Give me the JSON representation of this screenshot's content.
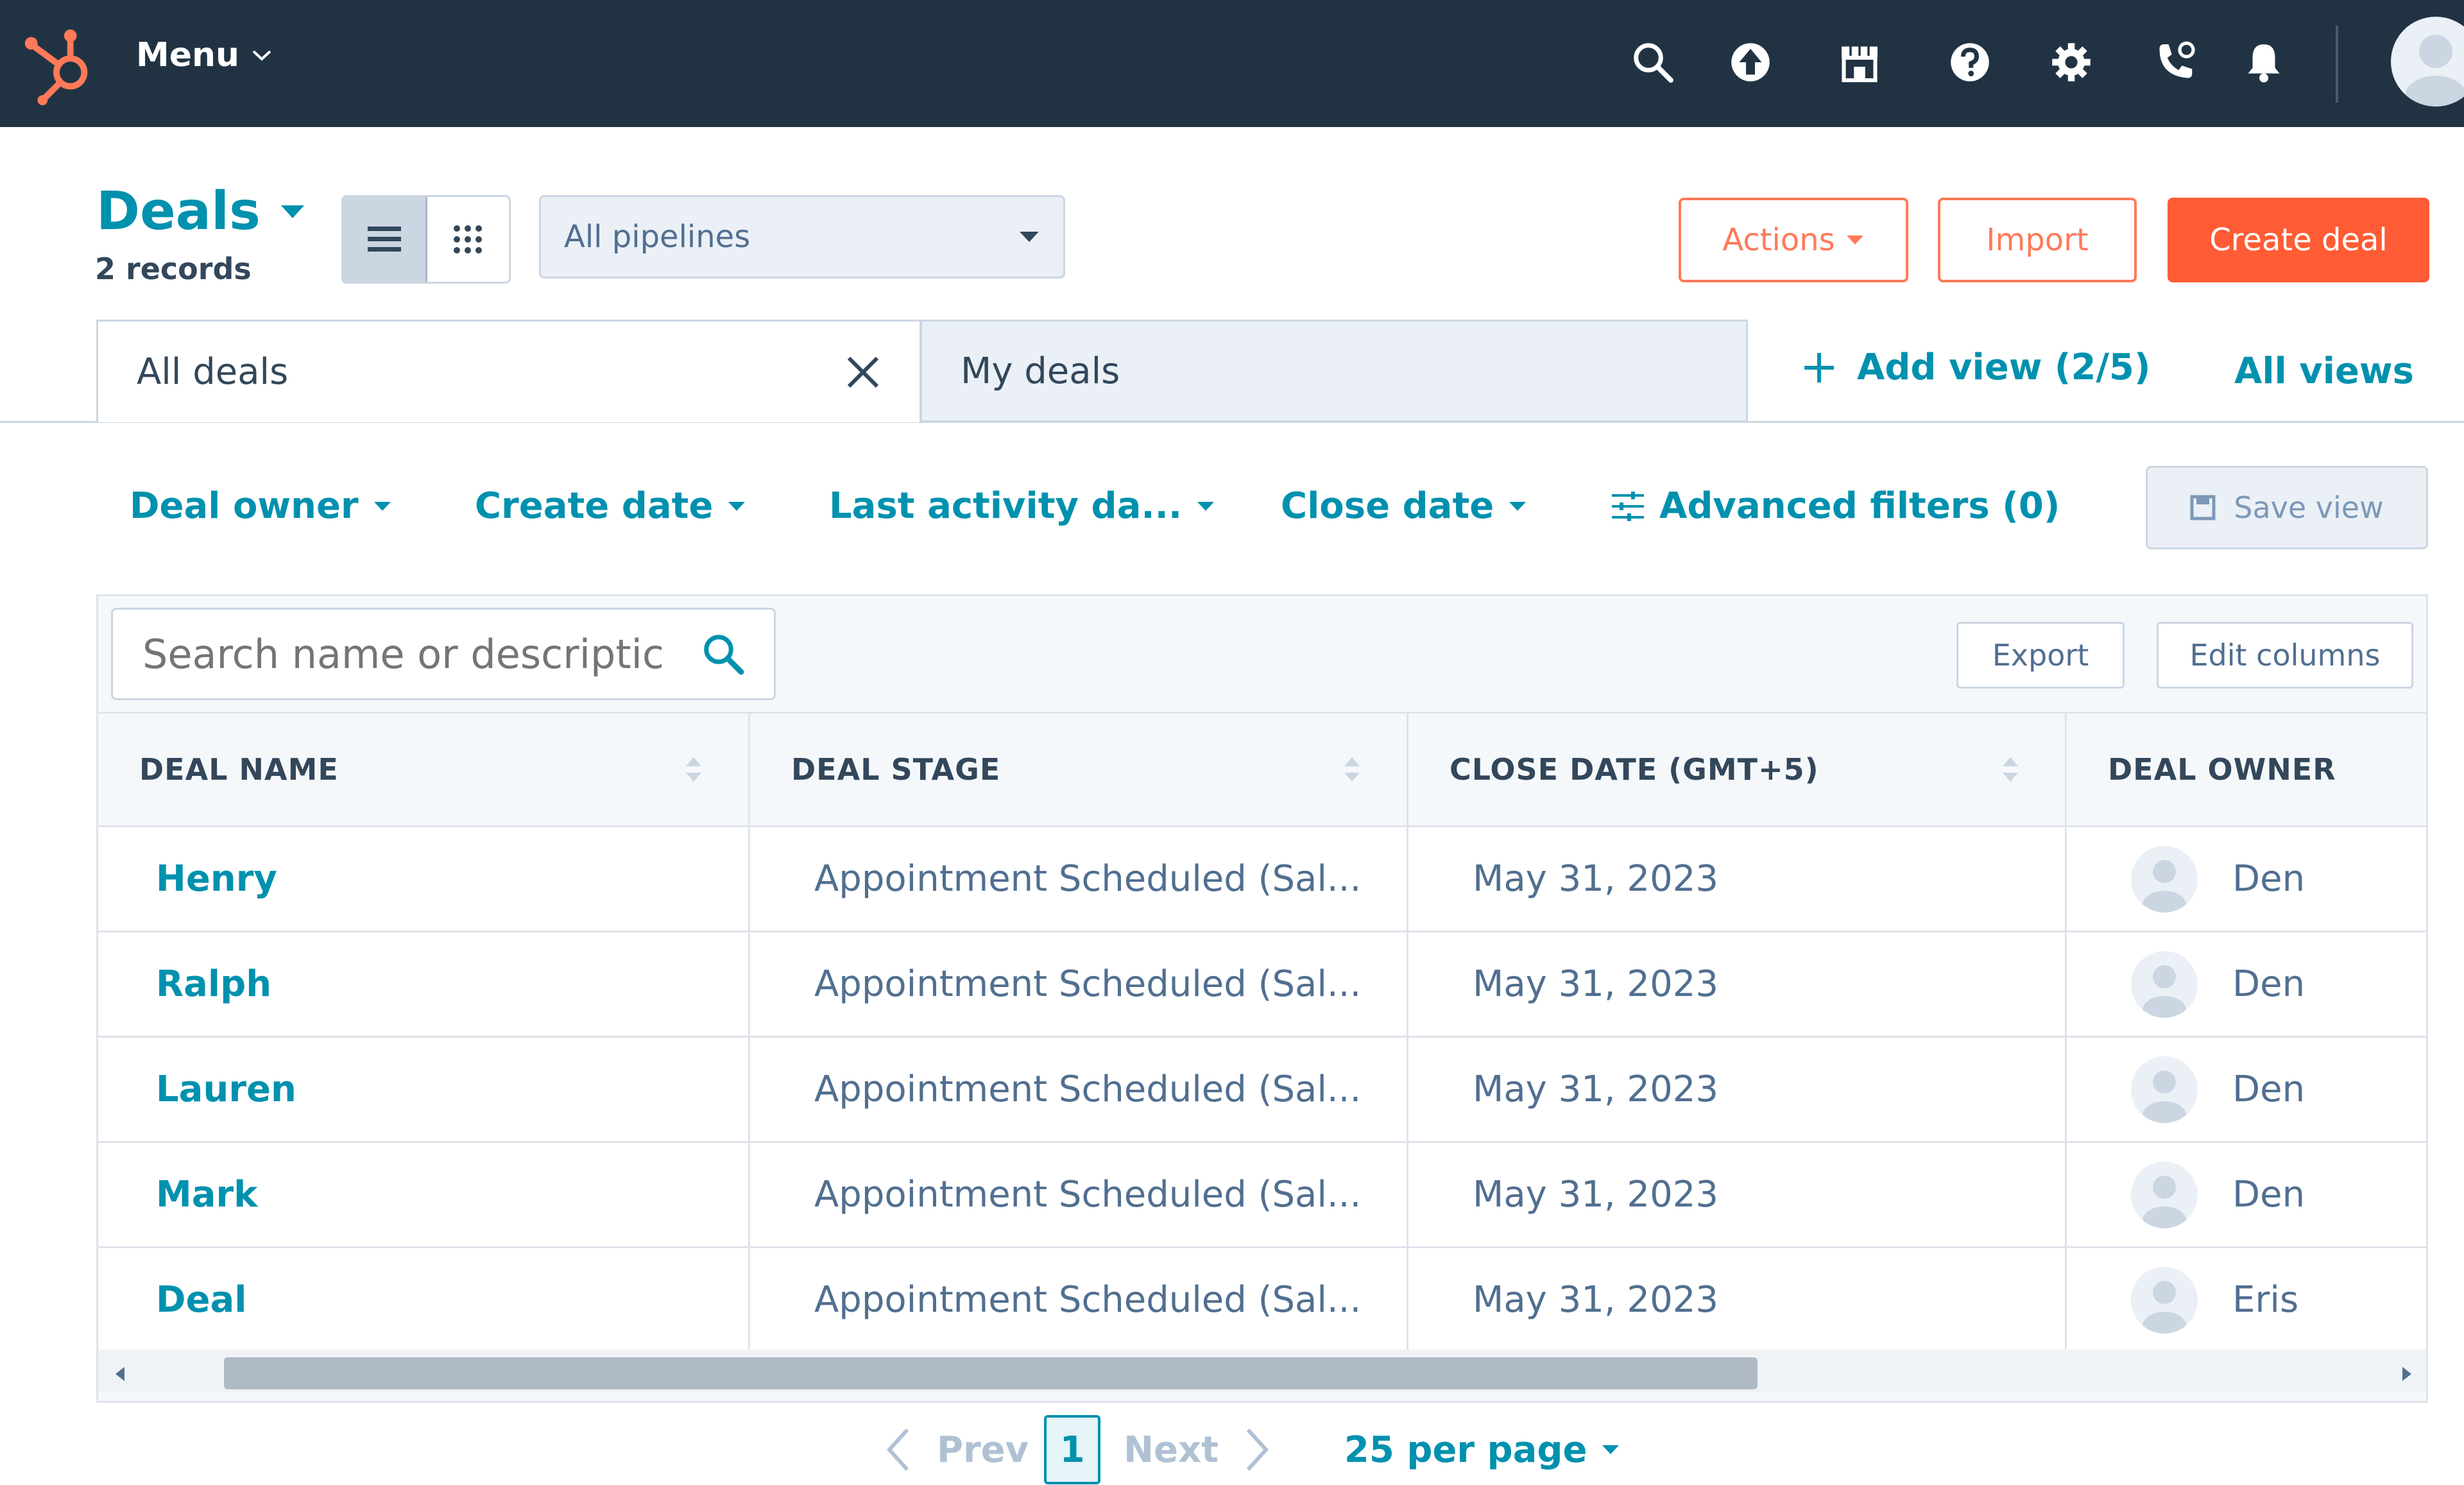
{
  "nav": {
    "menu_label": "Menu",
    "icons": [
      "search-icon",
      "upgrade-icon",
      "marketplace-icon",
      "help-icon",
      "settings-icon",
      "calling-icon",
      "notifications-icon"
    ]
  },
  "header": {
    "title": "Deals",
    "record_count": "2 records",
    "pipeline": "All pipelines",
    "actions_label": "Actions",
    "import_label": "Import",
    "create_label": "Create deal"
  },
  "tabs": [
    {
      "label": "All deals",
      "active": true
    },
    {
      "label": "My deals",
      "active": false
    }
  ],
  "add_view_label": "Add view (2/5)",
  "all_views_label": "All views",
  "filters": [
    {
      "label": "Deal owner"
    },
    {
      "label": "Create date"
    },
    {
      "label": "Last activity da..."
    },
    {
      "label": "Close date"
    }
  ],
  "advanced_filters_label": "Advanced filters (0)",
  "save_view_label": "Save view",
  "search": {
    "placeholder": "Search name or descriptic",
    "value": ""
  },
  "export_label": "Export",
  "edit_columns_label": "Edit columns",
  "table": {
    "columns": [
      "DEAL NAME",
      "DEAL STAGE",
      "CLOSE DATE (GMT+5)",
      "DEAL OWNER"
    ],
    "rows": [
      {
        "name": "Henry",
        "stage": "Appointment Scheduled (Sal...",
        "close_date": "May 31, 2023",
        "owner": "Den"
      },
      {
        "name": "Ralph",
        "stage": "Appointment Scheduled (Sal...",
        "close_date": "May 31, 2023",
        "owner": "Den"
      },
      {
        "name": "Lauren",
        "stage": "Appointment Scheduled (Sal...",
        "close_date": "May 31, 2023",
        "owner": "Den"
      },
      {
        "name": "Mark",
        "stage": "Appointment Scheduled (Sal...",
        "close_date": "May 31, 2023",
        "owner": "Den"
      },
      {
        "name": "Deal",
        "stage": "Appointment Scheduled (Sal...",
        "close_date": "May 31, 2023",
        "owner": "Eris"
      }
    ]
  },
  "pagination": {
    "prev": "Prev",
    "page": "1",
    "next": "Next",
    "per_page": "25 per page"
  },
  "colors": {
    "nav_bg": "#213343",
    "accent": "#0091ae",
    "brand_orange": "#ff5c35",
    "text": "#33475b"
  }
}
